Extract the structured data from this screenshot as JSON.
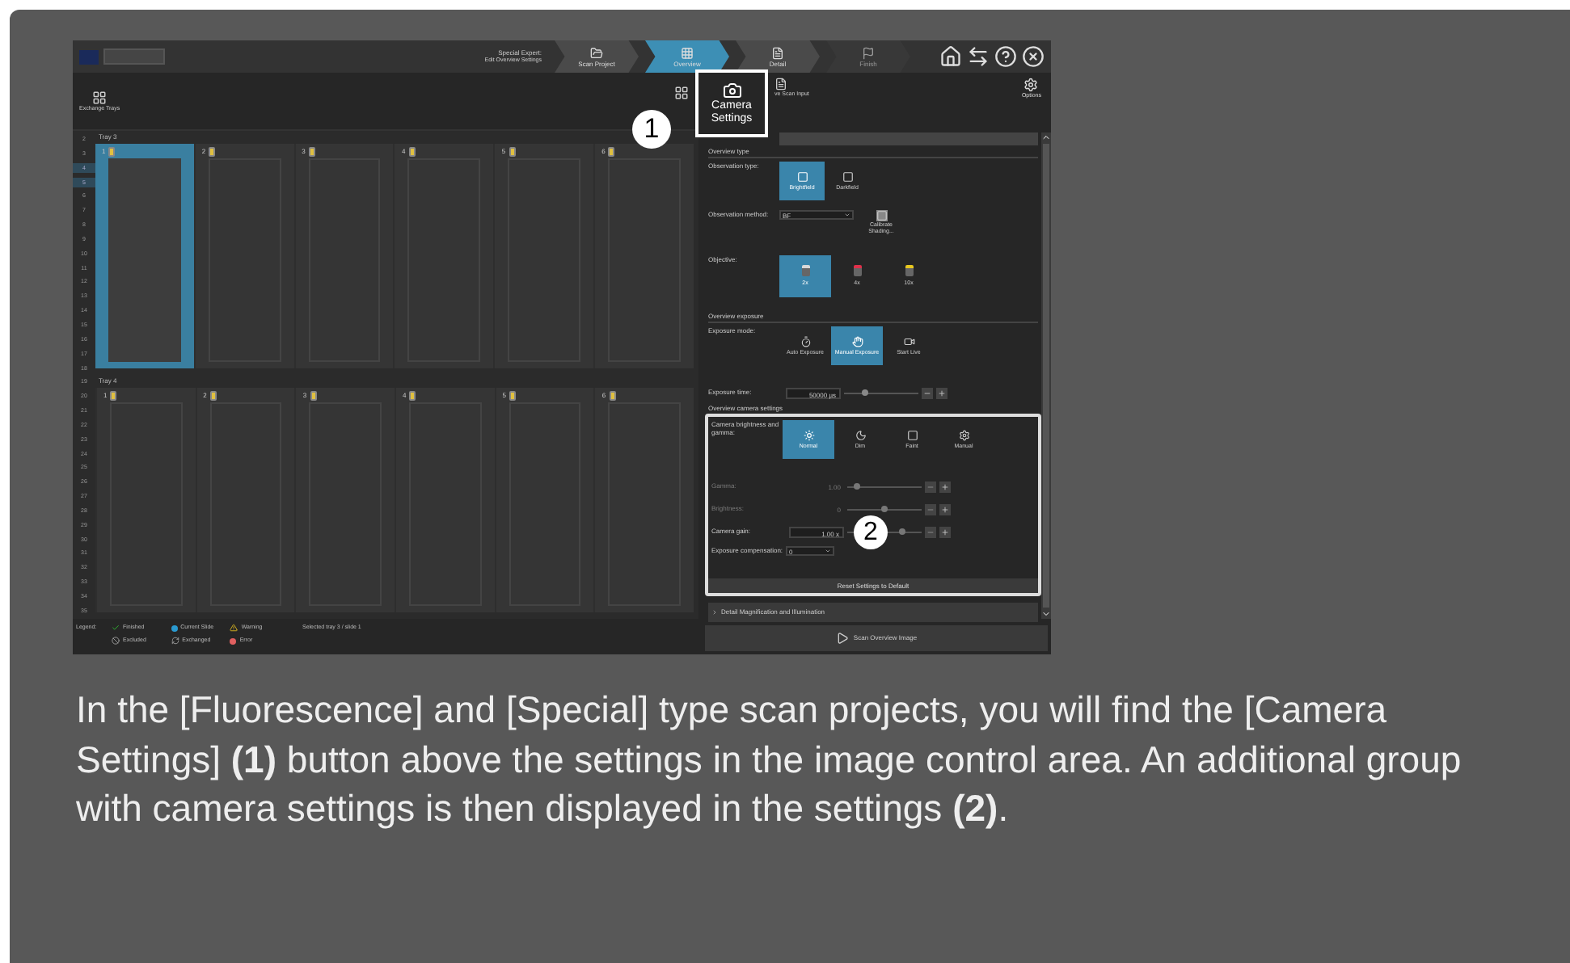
{
  "app": {
    "header": {
      "title": "Special Expert:",
      "subtitle": "Edit Overview Settings"
    },
    "steps": [
      {
        "label": "Scan Project",
        "selected": false,
        "disabled": false
      },
      {
        "label": "Overview",
        "selected": true,
        "disabled": false
      },
      {
        "label": "Detail",
        "selected": false,
        "disabled": false
      },
      {
        "label": "Finish",
        "selected": false,
        "disabled": true
      }
    ],
    "left_toolbar": {
      "exchange_trays": "Exchange Trays"
    },
    "right_toolbar": {
      "camera_settings": "Camera Settings",
      "scan_input": "ve Scan Input",
      "options": "Options"
    },
    "row_numbers": [
      {
        "label": "2",
        "selected": false
      },
      {
        "label": "3",
        "selected": false
      },
      {
        "label": "4",
        "selected": true
      },
      {
        "label": "5",
        "selected": true
      },
      {
        "label": "6",
        "selected": false
      },
      {
        "label": "7",
        "selected": false
      },
      {
        "label": "8",
        "selected": false
      },
      {
        "label": "9",
        "selected": false
      },
      {
        "label": "10",
        "selected": false
      },
      {
        "label": "11",
        "selected": false
      },
      {
        "label": "12",
        "selected": false
      },
      {
        "label": "13",
        "selected": false
      },
      {
        "label": "14",
        "selected": false
      },
      {
        "label": "15",
        "selected": false
      },
      {
        "label": "16",
        "selected": false
      },
      {
        "label": "17",
        "selected": false
      },
      {
        "label": "18",
        "selected": false
      },
      {
        "label": "19",
        "selected": false
      },
      {
        "label": "20",
        "selected": false
      },
      {
        "label": "21",
        "selected": false
      },
      {
        "label": "22",
        "selected": false
      },
      {
        "label": "23",
        "selected": false
      },
      {
        "label": "24",
        "selected": false
      },
      {
        "label": "25",
        "selected": false
      },
      {
        "label": "26",
        "selected": false
      },
      {
        "label": "27",
        "selected": false
      },
      {
        "label": "28",
        "selected": false
      },
      {
        "label": "29",
        "selected": false
      },
      {
        "label": "30",
        "selected": false
      },
      {
        "label": "31",
        "selected": false
      },
      {
        "label": "32",
        "selected": false
      },
      {
        "label": "33",
        "selected": false
      },
      {
        "label": "34",
        "selected": false
      },
      {
        "label": "35",
        "selected": false
      }
    ],
    "trays": [
      {
        "label": "Tray 3",
        "slides": [
          {
            "number": "1",
            "selected": true
          },
          {
            "number": "2",
            "selected": false
          },
          {
            "number": "3",
            "selected": false
          },
          {
            "number": "4",
            "selected": false
          },
          {
            "number": "5",
            "selected": false
          },
          {
            "number": "6",
            "selected": false
          }
        ]
      },
      {
        "label": "Tray 4",
        "slides": [
          {
            "number": "1",
            "selected": false
          },
          {
            "number": "2",
            "selected": false
          },
          {
            "number": "3",
            "selected": false
          },
          {
            "number": "4",
            "selected": false
          },
          {
            "number": "5",
            "selected": false
          },
          {
            "number": "6",
            "selected": false
          }
        ]
      }
    ],
    "legend": {
      "label": "Legend:",
      "items": [
        {
          "label": "Finished",
          "kind": "check"
        },
        {
          "label": "Current Slide",
          "kind": "dot"
        },
        {
          "label": "Warning",
          "kind": "warning"
        },
        {
          "label": "Excluded",
          "kind": "excluded"
        },
        {
          "label": "Exchanged",
          "kind": "exchanged"
        },
        {
          "label": "Error",
          "kind": "error"
        }
      ],
      "selection": "Selected tray 3 / slide 1"
    },
    "settings": {
      "overview_type": {
        "title": "Overview type",
        "observation_type": {
          "label": "Observation type:",
          "options": [
            {
              "label": "Brightfield",
              "selected": true
            },
            {
              "label": "Darkfield",
              "selected": false
            }
          ]
        },
        "observation_method": {
          "label": "Observation method:",
          "value": "BF"
        },
        "calibrate": "Calibrate Shading...",
        "objective": {
          "label": "Objective:",
          "options": [
            {
              "label": "2x",
              "selected": true,
              "color": "#d8d8d8"
            },
            {
              "label": "4x",
              "selected": false,
              "color": "#e0304a"
            },
            {
              "label": "10x",
              "selected": false,
              "color": "#e8c820"
            }
          ]
        }
      },
      "overview_exposure": {
        "title": "Overview exposure",
        "exposure_mode": {
          "label": "Exposure mode:",
          "options": [
            {
              "label": "Auto Exposure",
              "selected": false
            },
            {
              "label": "Manual Exposure",
              "selected": true
            },
            {
              "label": "Start Live",
              "selected": false
            }
          ]
        },
        "exposure_time": {
          "label": "Exposure time:",
          "value": "50000 µs",
          "level": 0.25
        }
      },
      "camera_settings": {
        "title": "Overview camera settings",
        "brightness_gamma": {
          "label": "Camera brightness and gamma:",
          "options": [
            {
              "label": "Normal",
              "selected": true
            },
            {
              "label": "Dim",
              "selected": false
            },
            {
              "label": "Faint",
              "selected": false
            },
            {
              "label": "Manual",
              "selected": false
            }
          ]
        },
        "sliders": [
          {
            "label": "Gamma:",
            "value": "1.00",
            "level": 0.1,
            "disabled": true
          },
          {
            "label": "Brightness:",
            "value": "0",
            "level": 0.5,
            "disabled": true
          },
          {
            "label": "Camera gain:",
            "value": "1.00 x",
            "level": 0.75,
            "disabled": false
          }
        ],
        "exposure_compensation": {
          "label": "Exposure compensation:",
          "value": "0"
        },
        "reset": "Reset Settings to Default"
      },
      "detail_section": {
        "label": "Detail Magnification and Illumination",
        "expanded": false
      }
    },
    "scan_button": "Scan Overview Image",
    "callouts": [
      "1",
      "2"
    ]
  },
  "caption": "In the [Fluorescence] and [Special] type scan projects, you will find the [Camera Settings] **(1)** button above the settings in the image control area. An additional group with camera settings is then displayed in the settings **(2)**."
}
